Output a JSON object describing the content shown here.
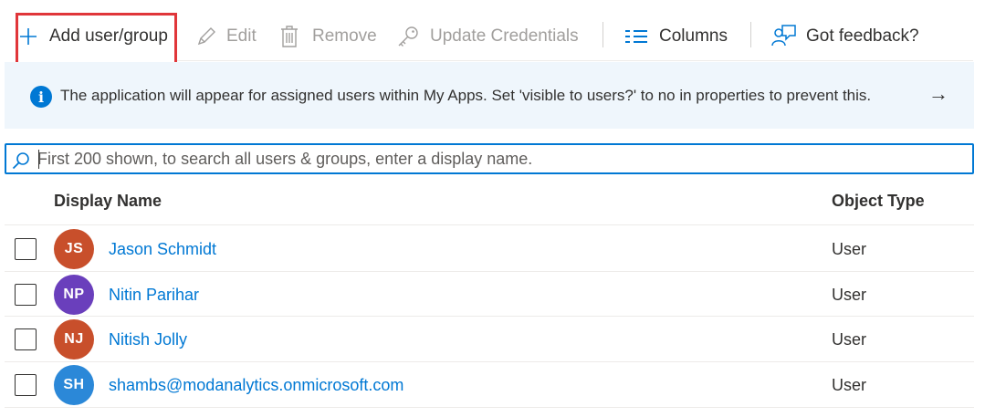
{
  "toolbar": {
    "add_label": "Add user/group",
    "edit_label": "Edit",
    "remove_label": "Remove",
    "update_label": "Update Credentials",
    "columns_label": "Columns",
    "feedback_label": "Got feedback?"
  },
  "banner": {
    "text": "The application will appear for assigned users within My Apps. Set 'visible to users?' to no in properties to prevent this.",
    "arrow": "→"
  },
  "search": {
    "placeholder": "First 200 shown, to search all users & groups, enter a display name."
  },
  "table": {
    "columns": [
      "Display Name",
      "Object Type"
    ],
    "rows": [
      {
        "initials": "JS",
        "avatar_color": "#c84f2b",
        "name": "Jason Schmidt",
        "type": "User"
      },
      {
        "initials": "NP",
        "avatar_color": "#6a3fbc",
        "name": "Nitin Parihar",
        "type": "User"
      },
      {
        "initials": "NJ",
        "avatar_color": "#c84f2b",
        "name": "Nitish Jolly",
        "type": "User"
      },
      {
        "initials": "SH",
        "avatar_color": "#2b88d8",
        "name": "shambs@modanalytics.onmicrosoft.com",
        "type": "User"
      }
    ]
  },
  "colors": {
    "accent": "#0078d4",
    "highlight": "#e0363a",
    "banner_bg": "#eff6fc"
  }
}
